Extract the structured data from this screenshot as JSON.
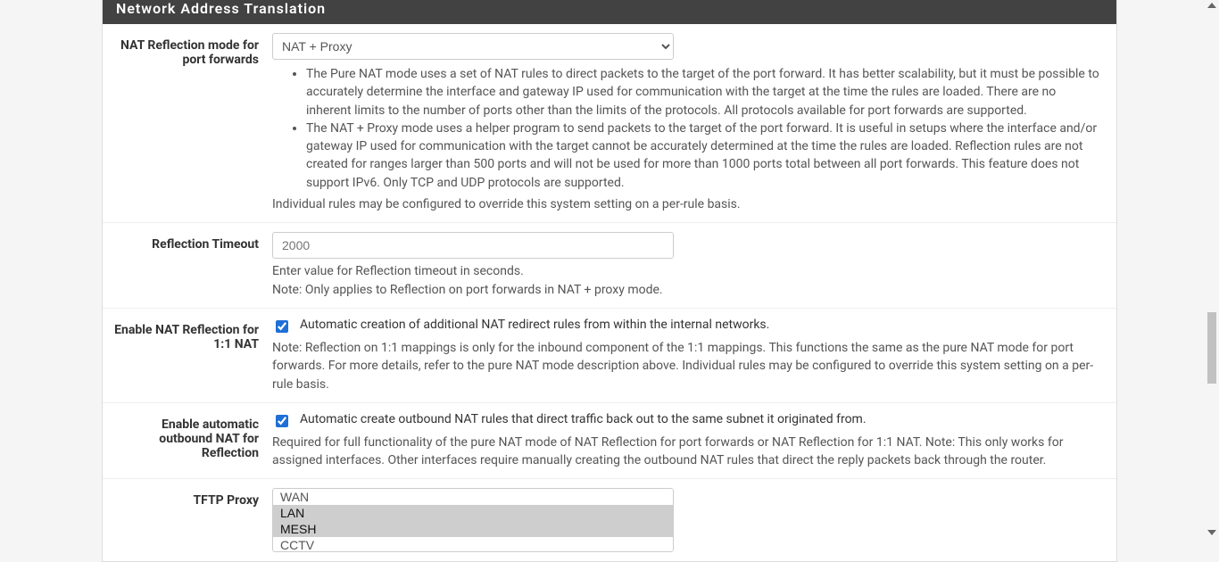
{
  "panel": {
    "title": "Network Address Translation"
  },
  "nat_reflection": {
    "label": "NAT Reflection mode for port forwards",
    "selected": "NAT + Proxy",
    "help_item1": "The Pure NAT mode uses a set of NAT rules to direct packets to the target of the port forward. It has better scalability, but it must be possible to accurately determine the interface and gateway IP used for communication with the target at the time the rules are loaded. There are no inherent limits to the number of ports other than the limits of the protocols. All protocols available for port forwards are supported.",
    "help_item2": "The NAT + Proxy mode uses a helper program to send packets to the target of the port forward. It is useful in setups where the interface and/or gateway IP used for communication with the target cannot be accurately determined at the time the rules are loaded. Reflection rules are not created for ranges larger than 500 ports and will not be used for more than 1000 ports total between all port forwards. This feature does not support IPv6. Only TCP and UDP protocols are supported.",
    "help_bottom": "Individual rules may be configured to override this system setting on a per-rule basis."
  },
  "reflection_timeout": {
    "label": "Reflection Timeout",
    "placeholder": "2000",
    "value": "",
    "help1": "Enter value for Reflection timeout in seconds.",
    "help2": "Note: Only applies to Reflection on port forwards in NAT + proxy mode."
  },
  "reflection_1to1": {
    "label": "Enable NAT Reflection for 1:1 NAT",
    "chk_label": "Automatic creation of additional NAT redirect rules from within the internal networks.",
    "help": "Note: Reflection on 1:1 mappings is only for the inbound component of the 1:1 mappings. This functions the same as the pure NAT mode for port forwards. For more details, refer to the pure NAT mode description above. Individual rules may be configured to override this system setting on a per-rule basis."
  },
  "auto_outbound": {
    "label": "Enable automatic outbound NAT for Reflection",
    "chk_label": "Automatic create outbound NAT rules that direct traffic back out to the same subnet it originated from.",
    "help": "Required for full functionality of the pure NAT mode of NAT Reflection for port forwards or NAT Reflection for 1:1 NAT. Note: This only works for assigned interfaces. Other interfaces require manually creating the outbound NAT rules that direct the reply packets back through the router."
  },
  "tftp": {
    "label": "TFTP Proxy",
    "options": [
      "WAN",
      "LAN",
      "MESH",
      "CCTV"
    ],
    "selected": [
      "LAN",
      "MESH"
    ]
  }
}
